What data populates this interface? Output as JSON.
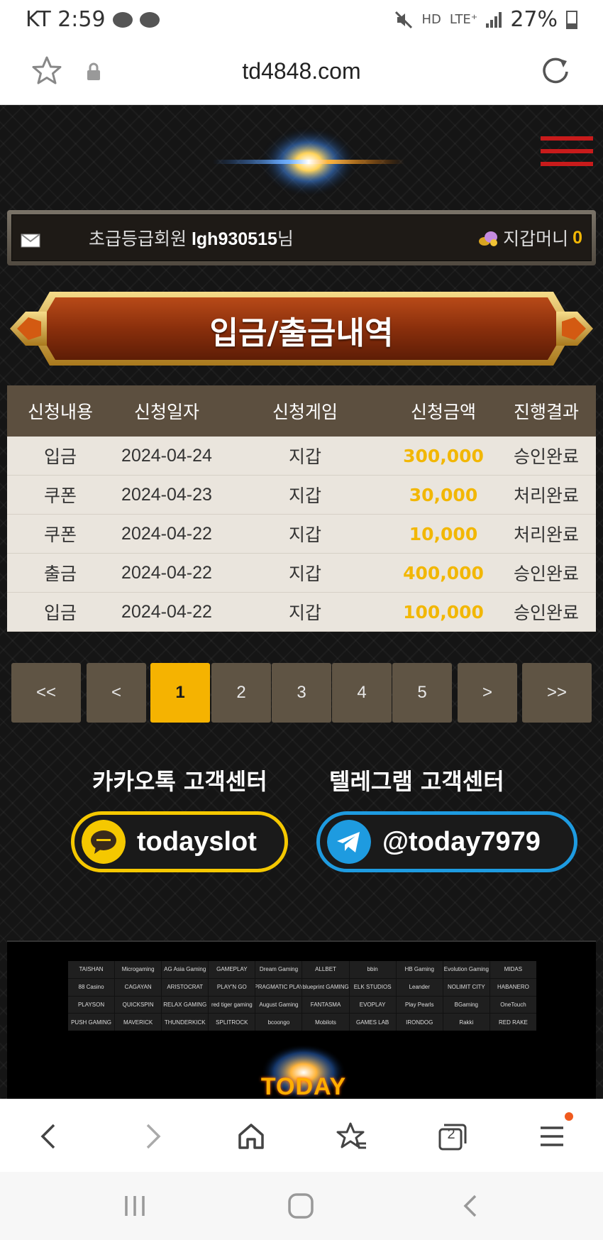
{
  "status_bar": {
    "carrier_time": "KT 2:59",
    "hd": "HD",
    "lte": "LTE⁺",
    "battery": "27%",
    "battery_level": 0.27
  },
  "browser": {
    "url": "td4848.com",
    "tab_count": "2"
  },
  "member": {
    "grade_label": "초급등급회원",
    "username": "lgh930515",
    "honorific": "님",
    "wallet_label": "지갑머니",
    "wallet_amount": "0"
  },
  "banner": {
    "title": "입금/출금내역"
  },
  "history": {
    "columns": [
      "신청내용",
      "신청일자",
      "신청게임",
      "신청금액",
      "진행결과"
    ],
    "rows": [
      {
        "type": "입금",
        "date": "2024-04-24",
        "game": "지갑",
        "amount": "300,000",
        "result": "승인완료"
      },
      {
        "type": "쿠폰",
        "date": "2024-04-23",
        "game": "지갑",
        "amount": "30,000",
        "result": "처리완료"
      },
      {
        "type": "쿠폰",
        "date": "2024-04-22",
        "game": "지갑",
        "amount": "10,000",
        "result": "처리완료"
      },
      {
        "type": "출금",
        "date": "2024-04-22",
        "game": "지갑",
        "amount": "400,000",
        "result": "승인완료"
      },
      {
        "type": "입금",
        "date": "2024-04-22",
        "game": "지갑",
        "amount": "100,000",
        "result": "승인완료"
      }
    ]
  },
  "pagination": {
    "first": "<<",
    "prev": "<",
    "pages": [
      "1",
      "2",
      "3",
      "4",
      "5"
    ],
    "current": "1",
    "next": ">",
    "last": ">>"
  },
  "support": {
    "kakao_label": "카카오톡 고객센터",
    "kakao_id": "todayslot",
    "telegram_label": "텔레그램 고객센터",
    "telegram_id": "@today7979"
  },
  "providers": [
    "TAISHAN",
    "Microgaming",
    "AG Asia Gaming",
    "GAMEPLAY",
    "Dream Gaming",
    "ALLBET",
    "bbin",
    "HB Gaming",
    "Evolution Gaming",
    "MIDAS",
    "88 Casino",
    "CAGAYAN",
    "ARISTOCRAT",
    "PLAY'N GO",
    "PRAGMATIC PLAY",
    "blueprint GAMING",
    "ELK STUDIOS",
    "Leander",
    "NOLIMIT CITY",
    "HABANERO",
    "PLAYSON",
    "QUICKSPIN",
    "RELAX GAMING",
    "red tiger gaming",
    "August Gaming",
    "FANTASMA",
    "EVOPLAY",
    "Play Pearls",
    "BGaming",
    "OneTouch",
    "PUSH GAMING",
    "MAVERICK",
    "THUNDERKICK",
    "SPLITROCK",
    "bcoongo",
    "Mobilots",
    "GAMES LAB",
    "IRONDOG",
    "Rakki",
    "RED RAKE"
  ],
  "footer": {
    "logo_text": "TODAY SLOT"
  },
  "colors": {
    "accent_gold": "#f2b705",
    "kakao_yellow": "#f5c800",
    "telegram_blue": "#1e9be0",
    "header_brown": "#5c4f3f",
    "menu_red": "#c81b1b"
  }
}
